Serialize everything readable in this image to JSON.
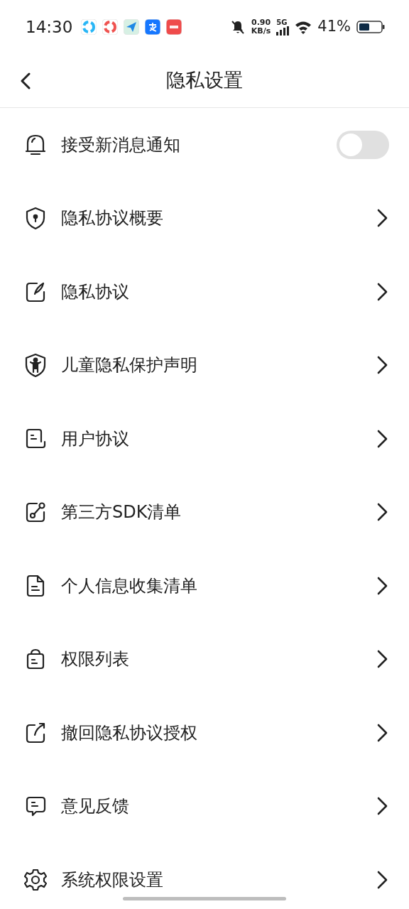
{
  "status_bar": {
    "time": "14:30",
    "net_speed": "0.90",
    "net_unit": "KB/s",
    "network": "5G",
    "battery": "41%"
  },
  "header": {
    "title": "隐私设置"
  },
  "items": [
    {
      "label": "接受新消息通知",
      "kind": "toggle",
      "on": false
    },
    {
      "label": "隐私协议概要",
      "kind": "link"
    },
    {
      "label": "隐私协议",
      "kind": "link"
    },
    {
      "label": "儿童隐私保护声明",
      "kind": "link"
    },
    {
      "label": "用户协议",
      "kind": "link"
    },
    {
      "label": "第三方SDK清单",
      "kind": "link"
    },
    {
      "label": "个人信息收集清单",
      "kind": "link"
    },
    {
      "label": "权限列表",
      "kind": "link"
    },
    {
      "label": "撤回隐私协议授权",
      "kind": "link"
    },
    {
      "label": "意见反馈",
      "kind": "link"
    },
    {
      "label": "系统权限设置",
      "kind": "link"
    }
  ]
}
